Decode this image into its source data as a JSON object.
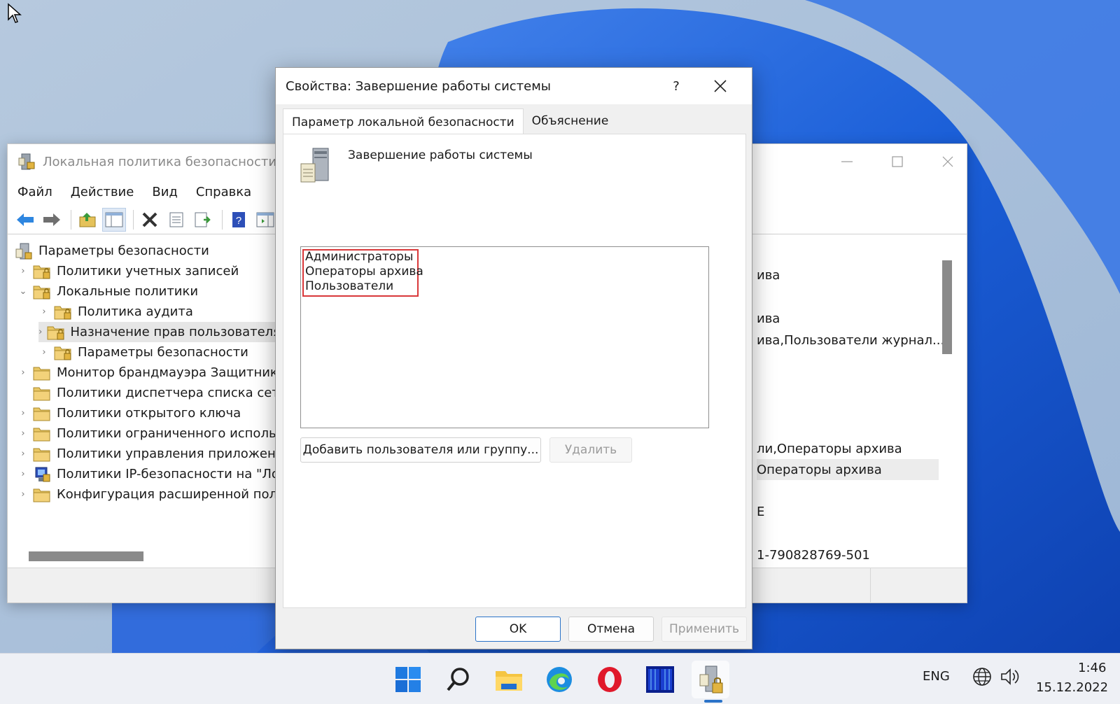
{
  "main_window": {
    "title": "Локальная политика безопасности",
    "menu": [
      "Файл",
      "Действие",
      "Вид",
      "Справка"
    ],
    "tree": [
      {
        "label": "Параметры безопасности",
        "level": 0
      },
      {
        "label": "Политики учетных записей",
        "level": 1,
        "expander": "›"
      },
      {
        "label": "Локальные политики",
        "level": 1,
        "expander": "⌄"
      },
      {
        "label": "Политика аудита",
        "level": 2,
        "expander": "›"
      },
      {
        "label": "Назначение прав пользователя",
        "level": 2,
        "expander": "›",
        "selected": true
      },
      {
        "label": "Параметры безопасности",
        "level": 2,
        "expander": "›"
      },
      {
        "label": "Монитор брандмауэра Защитника",
        "level": 1,
        "expander": "›"
      },
      {
        "label": "Политики диспетчера списка сетей",
        "level": 1
      },
      {
        "label": "Политики открытого ключа",
        "level": 1,
        "expander": "›"
      },
      {
        "label": "Политики ограниченного использо",
        "level": 1,
        "expander": "›"
      },
      {
        "label": "Политики управления приложения",
        "level": 1,
        "expander": "›"
      },
      {
        "label": "Политики IP-безопасности на \"Лок",
        "level": 1,
        "expander": "›"
      },
      {
        "label": "Конфигурация расширенной поли",
        "level": 1,
        "expander": "›"
      }
    ],
    "right_rows": [
      "ива",
      "ива",
      "ива,Пользователи журнал...",
      "ли,Операторы архива",
      "Операторы архива",
      "Е",
      "1-790828769-501"
    ]
  },
  "dialog": {
    "title": "Свойства: Завершение работы системы",
    "help": "?",
    "tabs": [
      "Параметр локальной безопасности",
      "Объяснение"
    ],
    "policy_name": "Завершение работы системы",
    "users": [
      "Администраторы",
      "Операторы архива",
      "Пользователи"
    ],
    "add_button": "Добавить пользователя или группу...",
    "remove_button": "Удалить",
    "ok_button": "OK",
    "cancel_button": "Отмена",
    "apply_button": "Применить"
  },
  "taskbar": {
    "lang": "ENG",
    "time": "1:46",
    "date": "15.12.2022"
  },
  "colors": {
    "accent": "#2b73c8",
    "highlight_border": "#d9383a",
    "wallpaper_blue": "#1b5fd8"
  }
}
